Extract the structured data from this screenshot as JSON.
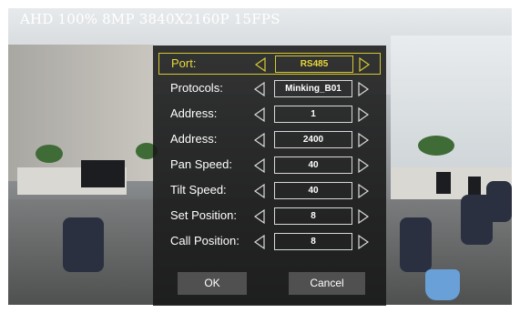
{
  "osd": {
    "title": "AHD 100% 8MP 3840X2160P 15FPS"
  },
  "menu": {
    "rows": [
      {
        "label": "Port:",
        "value": "RS485",
        "selected": true
      },
      {
        "label": "Protocols:",
        "value": "Minking_B01",
        "selected": false
      },
      {
        "label": "Address:",
        "value": "1",
        "selected": false
      },
      {
        "label": "Address:",
        "value": "2400",
        "selected": false
      },
      {
        "label": "Pan Speed:",
        "value": "40",
        "selected": false
      },
      {
        "label": "Tilt Speed:",
        "value": "40",
        "selected": false
      },
      {
        "label": "Set Position:",
        "value": "8",
        "selected": false
      },
      {
        "label": "Call Position:",
        "value": "8",
        "selected": false
      }
    ],
    "ok_label": "OK",
    "cancel_label": "Cancel"
  },
  "icons": {
    "left_arrow": "triangle-left-icon",
    "right_arrow": "triangle-right-icon"
  },
  "colors": {
    "highlight": "#d7c830",
    "panel": "#161616",
    "button": "#505050",
    "text": "#ffffff"
  }
}
